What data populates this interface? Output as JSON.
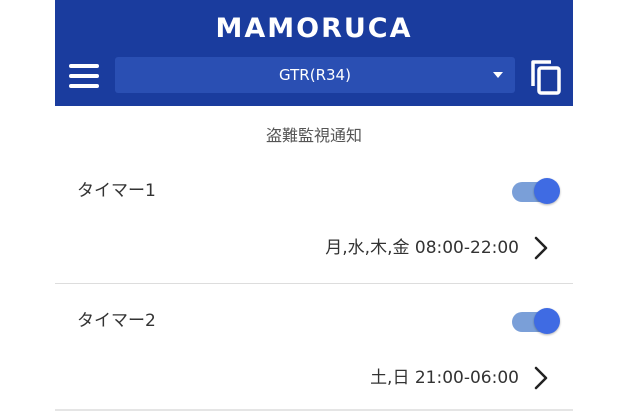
{
  "header": {
    "brand": "MAMORUCA",
    "vehicle_select": {
      "selected": "GTR(R34)"
    },
    "icons": {
      "menu": "hamburger-menu-icon",
      "copy": "copy-icon"
    },
    "background_color": "#1a3c9e",
    "select_color": "#2a4fb3"
  },
  "section": {
    "title": "盗難監視通知"
  },
  "timers": [
    {
      "name": "タイマー1",
      "enabled": true,
      "schedule": "月,水,木,金 08:00-22:00"
    },
    {
      "name": "タイマー2",
      "enabled": true,
      "schedule": "土,日 21:00-06:00"
    }
  ],
  "colors": {
    "toggle_track": "#7a9fd8",
    "toggle_knob": "#3f6be3"
  }
}
